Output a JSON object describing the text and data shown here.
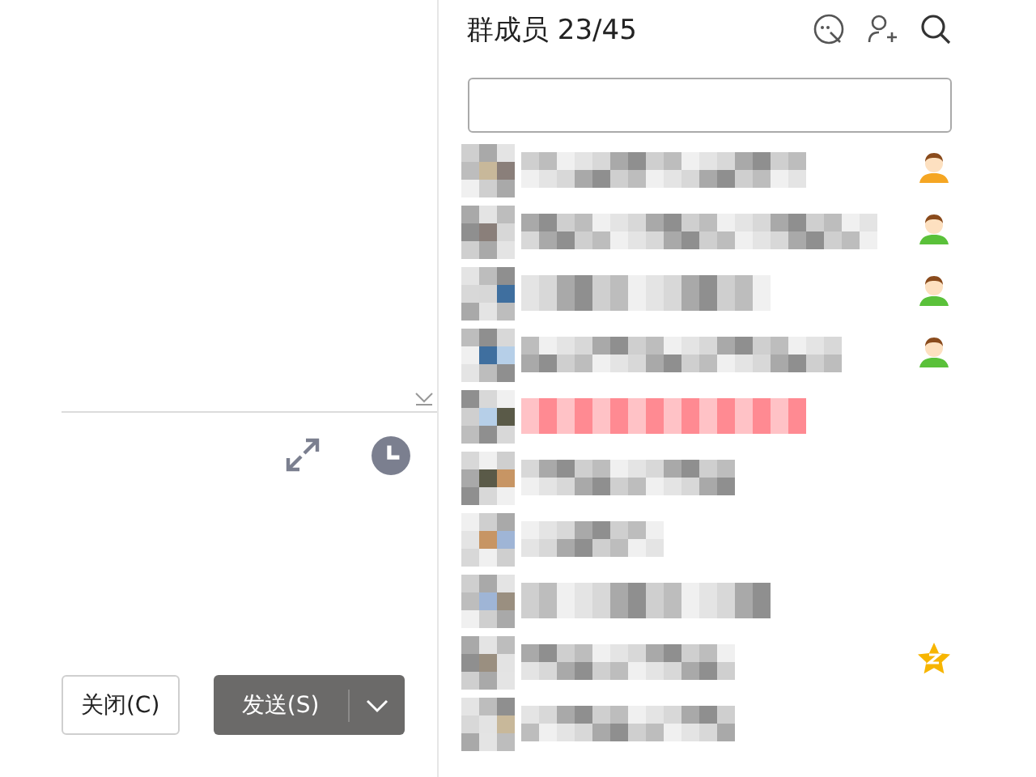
{
  "compose": {
    "close_button": "关闭(C)",
    "send_button": "发送(S)"
  },
  "members": {
    "title": "群成员 23/45",
    "rows": [
      {
        "kind": "owner",
        "vip": false
      },
      {
        "kind": "admin",
        "vip": false
      },
      {
        "kind": "admin",
        "vip": false
      },
      {
        "kind": "admin",
        "vip": false
      },
      {
        "kind": "plain",
        "vip": true
      },
      {
        "kind": "plain",
        "vip": false
      },
      {
        "kind": "plain",
        "vip": false
      },
      {
        "kind": "plain",
        "vip": false
      },
      {
        "kind": "star",
        "vip": false
      },
      {
        "kind": "plain",
        "vip": false
      }
    ]
  }
}
